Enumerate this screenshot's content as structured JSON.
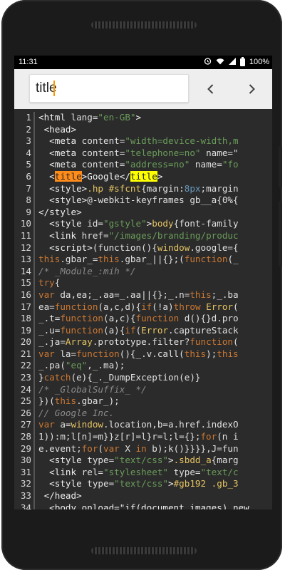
{
  "status_bar": {
    "time": "11:31",
    "battery": "100%"
  },
  "search": {
    "value": "title"
  },
  "colors": {
    "editor_bg": "#2b2b2b",
    "match_current": "#ff8c1a",
    "match_other": "#ffff00"
  },
  "editor": {
    "line_numbers": [
      "1",
      "2",
      "3",
      "4",
      "5",
      "6",
      "7",
      "8",
      "9",
      "10",
      "11",
      "12",
      "13",
      "14",
      "15",
      "16",
      "17",
      "18",
      "19",
      "20",
      "21",
      "22",
      "23",
      "24",
      "25",
      "26",
      "27",
      "28",
      "29",
      "30",
      "31",
      "32",
      "33",
      "34"
    ],
    "lines": [
      [
        {
          "t": "<html ",
          "c": "t"
        },
        {
          "t": "lang=",
          "c": "a"
        },
        {
          "t": "\"en-GB\"",
          "c": "s"
        },
        {
          "t": ">",
          "c": "t"
        }
      ],
      [
        {
          "t": " <head>",
          "c": "t"
        }
      ],
      [
        {
          "t": "  <meta ",
          "c": "t"
        },
        {
          "t": "content=",
          "c": "a"
        },
        {
          "t": "\"width=device-width,m",
          "c": "s"
        }
      ],
      [
        {
          "t": "  <meta ",
          "c": "t"
        },
        {
          "t": "content=",
          "c": "a"
        },
        {
          "t": "\"telephone=no\"",
          "c": "s"
        },
        {
          "t": " name=\"",
          "c": "a"
        }
      ],
      [
        {
          "t": "  <meta ",
          "c": "t"
        },
        {
          "t": "content=",
          "c": "a"
        },
        {
          "t": "\"address=no\"",
          "c": "s"
        },
        {
          "t": " name=",
          "c": "a"
        },
        {
          "t": "\"fo",
          "c": "s"
        }
      ],
      [
        {
          "t": "  <",
          "c": "t"
        },
        {
          "t": "title",
          "c": "hl-or"
        },
        {
          "t": ">Google</",
          "c": "t"
        },
        {
          "t": "title",
          "c": "hl-ye"
        },
        {
          "t": ">",
          "c": "t"
        }
      ],
      [
        {
          "t": "  <style>",
          "c": "t"
        },
        {
          "t": ".hp #sfcnt",
          "c": "y"
        },
        {
          "t": "{margin:",
          "c": "a"
        },
        {
          "t": "8px",
          "c": "n"
        },
        {
          "t": ";margin",
          "c": "a"
        }
      ],
      [
        {
          "t": "  <style>",
          "c": "t"
        },
        {
          "t": "@-webkit-keyframes ",
          "c": "a"
        },
        {
          "t": "gb__a",
          "c": "a"
        },
        {
          "t": "{0%{",
          "c": "a"
        }
      ],
      [
        {
          "t": "</style>",
          "c": "t"
        }
      ],
      [
        {
          "t": "  <style ",
          "c": "t"
        },
        {
          "t": "id=",
          "c": "a"
        },
        {
          "t": "\"gstyle\"",
          "c": "s"
        },
        {
          "t": ">",
          "c": "t"
        },
        {
          "t": "body",
          "c": "y"
        },
        {
          "t": "{font-family",
          "c": "a"
        }
      ],
      [
        {
          "t": "  <link ",
          "c": "t"
        },
        {
          "t": "href=",
          "c": "a"
        },
        {
          "t": "\"/images/branding/produc",
          "c": "s"
        }
      ],
      [
        {
          "t": "  <script>",
          "c": "t"
        },
        {
          "t": "(function(){",
          "c": "a"
        },
        {
          "t": "window",
          "c": "y"
        },
        {
          "t": ".google={",
          "c": "a"
        }
      ],
      [
        {
          "t": "this",
          "c": "k"
        },
        {
          "t": ".gbar_=",
          "c": "a"
        },
        {
          "t": "this",
          "c": "k"
        },
        {
          "t": ".gbar_||{};(",
          "c": "a"
        },
        {
          "t": "function",
          "c": "k"
        },
        {
          "t": "(_",
          "c": "a"
        }
      ],
      [
        {
          "t": "/* _Module_:mih */",
          "c": "c"
        }
      ],
      [
        {
          "t": "try",
          "c": "k"
        },
        {
          "t": "{",
          "c": "a"
        }
      ],
      [
        {
          "t": "var ",
          "c": "k"
        },
        {
          "t": "da,ea;_.aa=_.aa||{};_.n=",
          "c": "a"
        },
        {
          "t": "this",
          "c": "k"
        },
        {
          "t": ";_.ba",
          "c": "a"
        }
      ],
      [
        {
          "t": "ea=",
          "c": "a"
        },
        {
          "t": "function",
          "c": "k"
        },
        {
          "t": "(a,c,d){",
          "c": "a"
        },
        {
          "t": "if",
          "c": "k"
        },
        {
          "t": "(!a)",
          "c": "a"
        },
        {
          "t": "throw ",
          "c": "k"
        },
        {
          "t": "Error",
          "c": "y"
        },
        {
          "t": "(",
          "c": "a"
        }
      ],
      [
        {
          "t": "_.t=",
          "c": "a"
        },
        {
          "t": "function",
          "c": "k"
        },
        {
          "t": "(a,c){",
          "c": "a"
        },
        {
          "t": "function ",
          "c": "k"
        },
        {
          "t": "d(){}d.pro",
          "c": "a"
        }
      ],
      [
        {
          "t": "_.u=",
          "c": "a"
        },
        {
          "t": "function",
          "c": "k"
        },
        {
          "t": "(a){",
          "c": "a"
        },
        {
          "t": "if",
          "c": "k"
        },
        {
          "t": "(",
          "c": "a"
        },
        {
          "t": "Error",
          "c": "y"
        },
        {
          "t": ".captureStack",
          "c": "a"
        }
      ],
      [
        {
          "t": "_.ja=",
          "c": "a"
        },
        {
          "t": "Array",
          "c": "y"
        },
        {
          "t": ".prototype.filter?",
          "c": "a"
        },
        {
          "t": "function",
          "c": "k"
        },
        {
          "t": "(",
          "c": "a"
        }
      ],
      [
        {
          "t": "var ",
          "c": "k"
        },
        {
          "t": "la=",
          "c": "a"
        },
        {
          "t": "function",
          "c": "k"
        },
        {
          "t": "(){_.v.call(",
          "c": "a"
        },
        {
          "t": "this",
          "c": "k"
        },
        {
          "t": ");",
          "c": "a"
        },
        {
          "t": "this",
          "c": "k"
        }
      ],
      [
        {
          "t": "_.pa(",
          "c": "a"
        },
        {
          "t": "\"eq\"",
          "c": "s"
        },
        {
          "t": ",_.ma);",
          "c": "a"
        }
      ],
      [
        {
          "t": "}",
          "c": "a"
        },
        {
          "t": "catch",
          "c": "k"
        },
        {
          "t": "(e){_._DumpException(e)}",
          "c": "a"
        }
      ],
      [
        {
          "t": "/* _GlobalSuffix_ */",
          "c": "c"
        }
      ],
      [
        {
          "t": "})(",
          "c": "a"
        },
        {
          "t": "this",
          "c": "k"
        },
        {
          "t": ".gbar_);",
          "c": "a"
        }
      ],
      [
        {
          "t": "// Google Inc.",
          "c": "c"
        }
      ],
      [
        {
          "t": "var ",
          "c": "k"
        },
        {
          "t": "a=",
          "c": "a"
        },
        {
          "t": "window",
          "c": "y"
        },
        {
          "t": ".location,b=a.href.indexO",
          "c": "a"
        }
      ],
      [
        {
          "t": "1)):m;l[n]=m}}z[r]=l}r=l;l={};",
          "c": "a"
        },
        {
          "t": "for",
          "c": "k"
        },
        {
          "t": "(n i",
          "c": "a"
        }
      ],
      [
        {
          "t": "e.event;",
          "c": "a"
        },
        {
          "t": "for",
          "c": "k"
        },
        {
          "t": "(",
          "c": "a"
        },
        {
          "t": "var ",
          "c": "k"
        },
        {
          "t": "X ",
          "c": "a"
        },
        {
          "t": "in ",
          "c": "k"
        },
        {
          "t": "b);k()}}}},J=fun",
          "c": "a"
        }
      ],
      [
        {
          "t": "  <style ",
          "c": "t"
        },
        {
          "t": "type=",
          "c": "a"
        },
        {
          "t": "\"text/css\"",
          "c": "s"
        },
        {
          "t": ">",
          "c": "t"
        },
        {
          "t": ".sbdd_a",
          "c": "y"
        },
        {
          "t": "{marg",
          "c": "a"
        }
      ],
      [
        {
          "t": "  <link ",
          "c": "t"
        },
        {
          "t": "rel=",
          "c": "a"
        },
        {
          "t": "\"stylesheet\"",
          "c": "s"
        },
        {
          "t": " type=",
          "c": "a"
        },
        {
          "t": "\"text/c",
          "c": "s"
        }
      ],
      [
        {
          "t": "  <style ",
          "c": "t"
        },
        {
          "t": "type=",
          "c": "a"
        },
        {
          "t": "\"text/css\"",
          "c": "s"
        },
        {
          "t": ">",
          "c": "t"
        },
        {
          "t": "#gb192 .gb_3",
          "c": "y"
        }
      ],
      [
        {
          "t": " </head>",
          "c": "t"
        }
      ],
      [
        {
          "t": "  <body onload=\"if(document.images) new",
          "c": "t"
        }
      ]
    ]
  }
}
